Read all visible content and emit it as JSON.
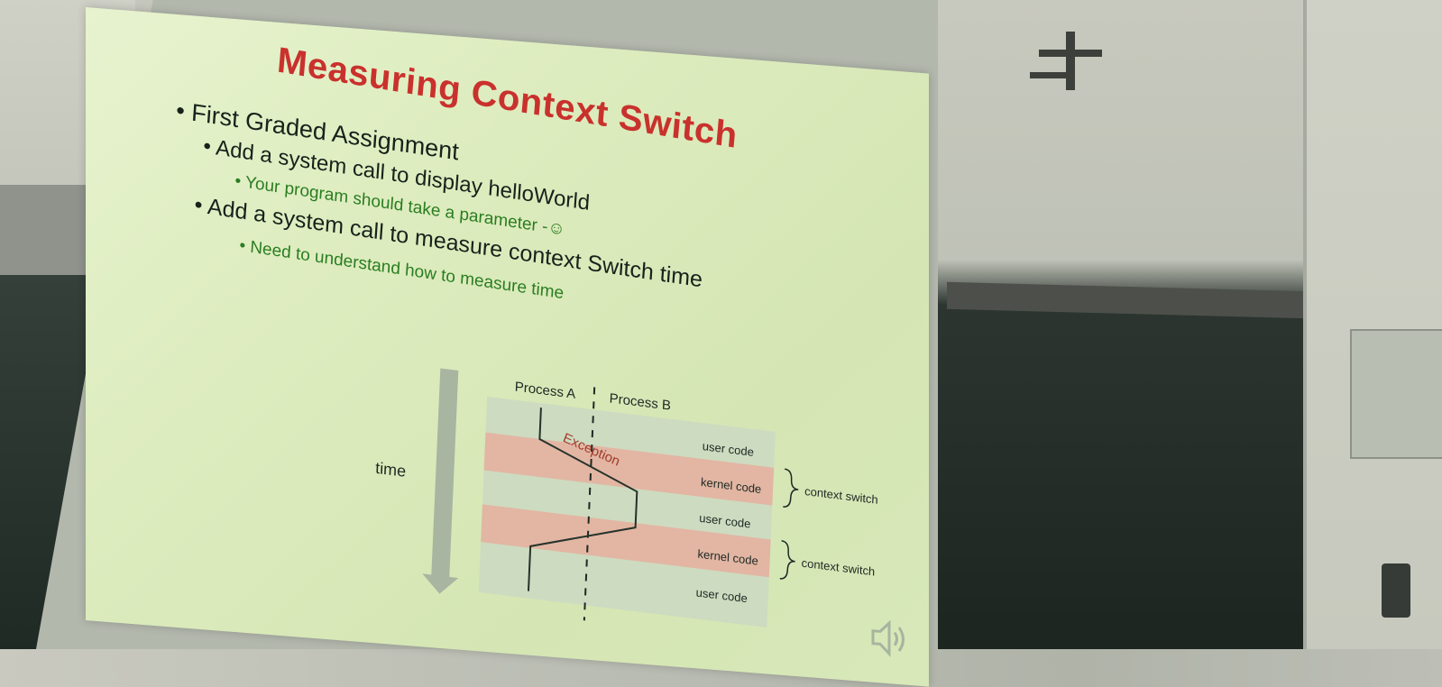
{
  "slide": {
    "title": "Measuring Context Switch",
    "bullets": [
      {
        "text": "First Graded Assignment"
      },
      {
        "text": "Add a system call to display helloWorld"
      },
      {
        "text": "Your program should take a parameter -☺"
      },
      {
        "text": "Add a system call to measure context Switch time"
      },
      {
        "text": "Need to understand how to measure time"
      }
    ]
  },
  "diagram": {
    "time_label": "time",
    "process_a": "Process A",
    "process_b": "Process B",
    "exception": "Exception",
    "rows": [
      "user code",
      "kernel code",
      "user code",
      "kernel code",
      "user code"
    ],
    "brackets": [
      "context switch",
      "context switch"
    ]
  },
  "colors": {
    "title": "#c9312d",
    "green_text": "#2a7d21",
    "kernel_band": "#e2b6a3"
  }
}
